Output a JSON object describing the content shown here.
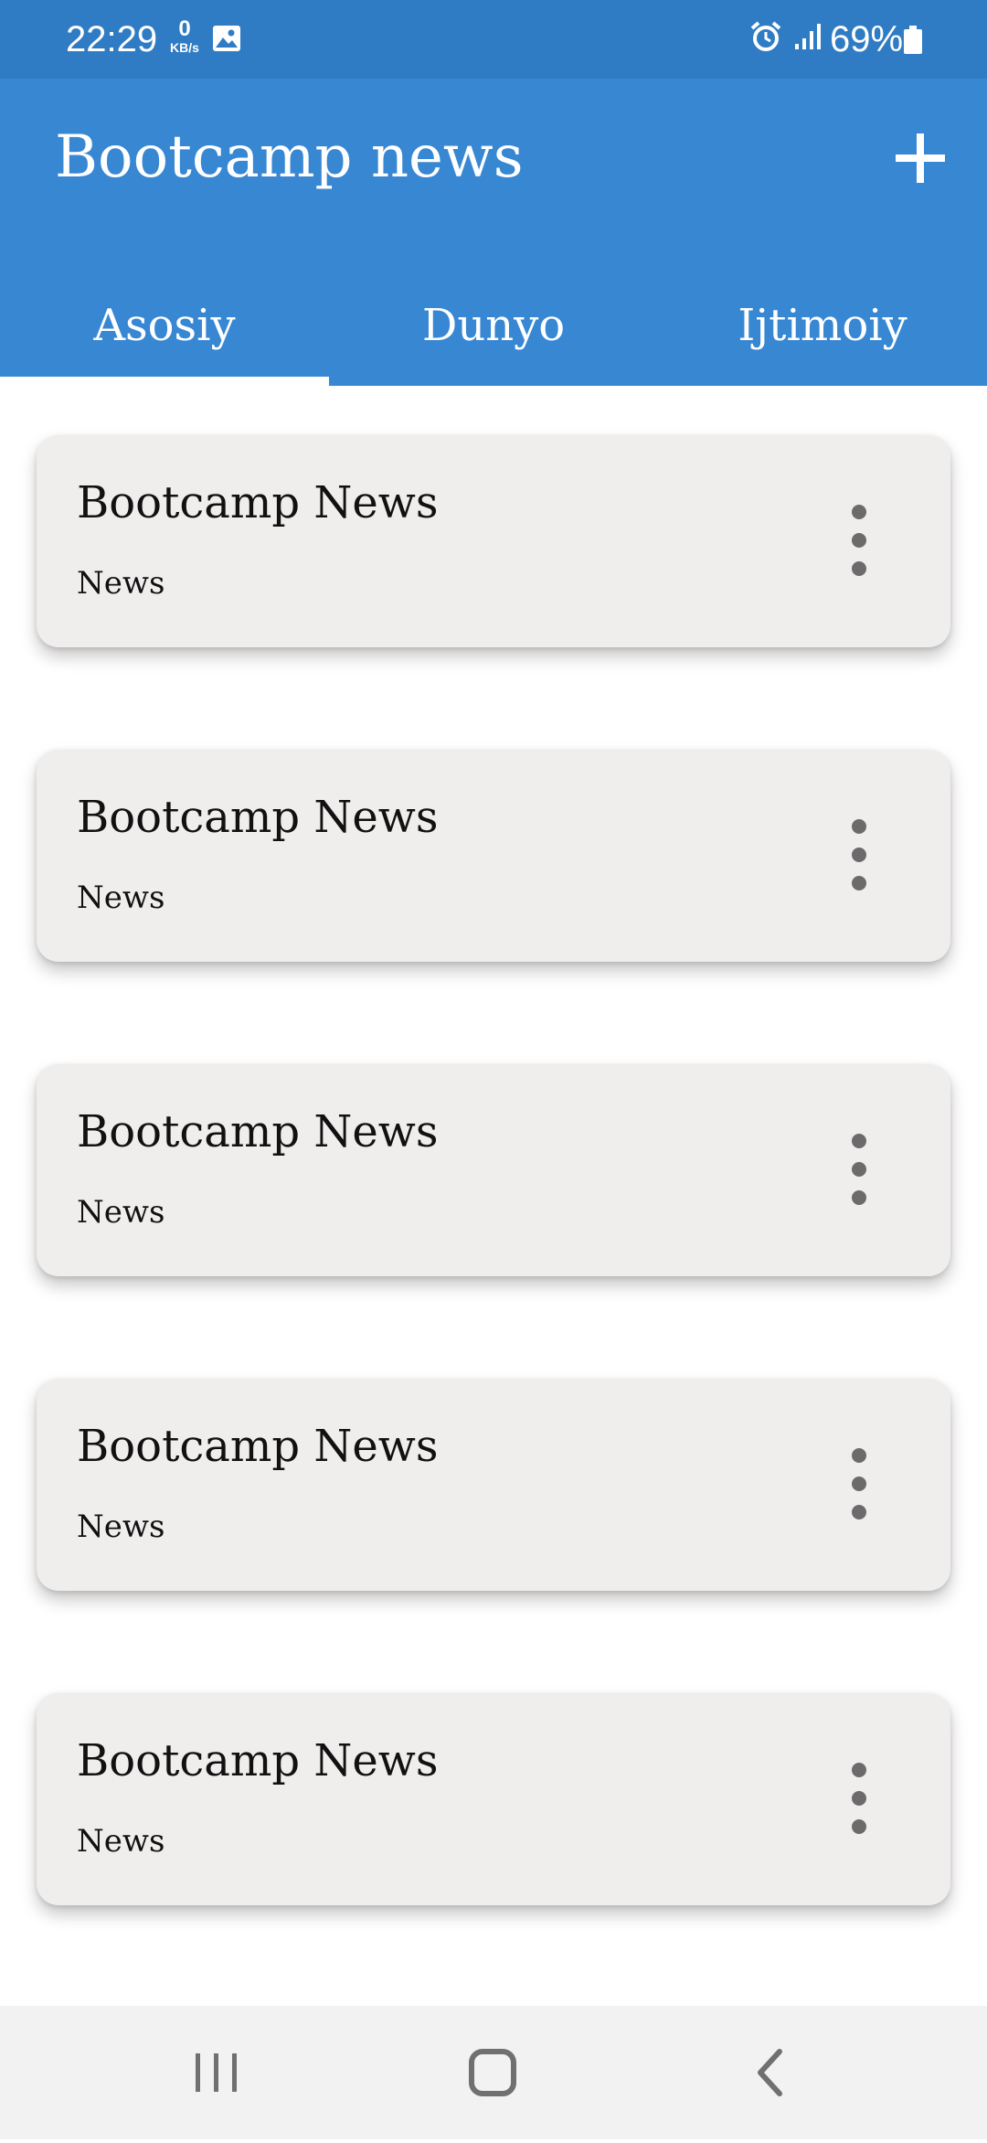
{
  "status_bar": {
    "time": "22:29",
    "data_rate_value": "0",
    "data_rate_unit": "KB/s",
    "battery": "69%",
    "icons": [
      "image-icon",
      "alarm-icon",
      "signal-icon",
      "battery-icon"
    ]
  },
  "app_bar": {
    "title": "Bootcamp news",
    "add_icon": "plus-icon"
  },
  "tabs": [
    {
      "label": "Asosiy",
      "selected": true
    },
    {
      "label": "Dunyo",
      "selected": false
    },
    {
      "label": "Ijtimoiy",
      "selected": false
    }
  ],
  "news": [
    {
      "title": "Bootcamp News",
      "subtitle": "News"
    },
    {
      "title": "Bootcamp News",
      "subtitle": "News"
    },
    {
      "title": "Bootcamp News",
      "subtitle": "News"
    },
    {
      "title": "Bootcamp News",
      "subtitle": "News"
    },
    {
      "title": "Bootcamp News",
      "subtitle": "News"
    }
  ],
  "nav_bar": {
    "icons": [
      "recent-apps-icon",
      "home-icon",
      "back-icon"
    ]
  },
  "colors": {
    "status_bar": "#2f7cc5",
    "app_bar": "#3887d3",
    "card_background": "#f0eded",
    "menu_dots": "#6b6b6b",
    "nav_bar": "#f2f2f2"
  }
}
